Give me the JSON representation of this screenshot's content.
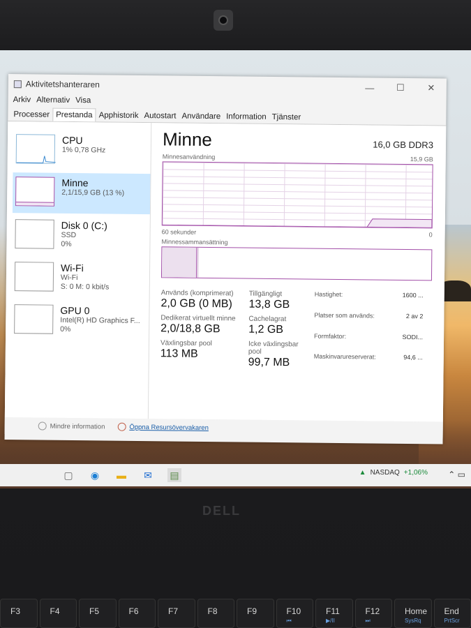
{
  "window": {
    "title": "Aktivitetshanteraren"
  },
  "menu": [
    "Arkiv",
    "Alternativ",
    "Visa"
  ],
  "tabs": [
    "Processer",
    "Prestanda",
    "Apphistorik",
    "Autostart",
    "Användare",
    "Information",
    "Tjänster"
  ],
  "active_tab": "Prestanda",
  "sidebar": [
    {
      "title": "CPU",
      "line1": "1% 0,78 GHz",
      "line2": ""
    },
    {
      "title": "Minne",
      "line1": "2,1/15,9 GB (13 %)",
      "line2": ""
    },
    {
      "title": "Disk 0 (C:)",
      "line1": "SSD",
      "line2": "0%"
    },
    {
      "title": "Wi-Fi",
      "line1": "Wi-Fi",
      "line2": "S: 0 M: 0 kbit/s"
    },
    {
      "title": "GPU 0",
      "line1": "Intel(R) HD Graphics F...",
      "line2": "0%"
    }
  ],
  "memory": {
    "title": "Minne",
    "spec": "16,0 GB DDR3",
    "usage_label": "Minnesanvändning",
    "usage_max": "15,9 GB",
    "time_label": "60 sekunder",
    "time_end": "0",
    "composition_label": "Minnessammansättning",
    "usage_fraction": 0.13,
    "stats": {
      "used_label": "Används (komprimerat)",
      "used": "2,0 GB (0 MB)",
      "avail_label": "Tillgängligt",
      "avail": "13,8 GB",
      "committed_label": "Dedikerat virtuellt minne",
      "committed": "2,0/18,8 GB",
      "cached_label": "Cachelagrat",
      "cached": "1,2 GB",
      "paged_label": "Växlingsbar pool",
      "paged": "113 MB",
      "nonpaged_label": "Icke växlingsbar pool",
      "nonpaged": "99,7 MB"
    },
    "details": [
      {
        "label": "Hastighet:",
        "value": "1600 ..."
      },
      {
        "label": "Platser som används:",
        "value": "2 av 2"
      },
      {
        "label": "Formfaktor:",
        "value": "SODI..."
      },
      {
        "label": "Maskinvarureserverat:",
        "value": "94,6 ..."
      }
    ]
  },
  "footer": {
    "less_info": "Mindre information",
    "open_monitor": "Öppna Resursövervakaren"
  },
  "taskbar": {
    "stock_name": "NASDAQ",
    "stock_change": "+1,06%"
  },
  "laptop": {
    "brand": "DELL",
    "keys": [
      {
        "label": "F3",
        "sub": ""
      },
      {
        "label": "F4",
        "sub": ""
      },
      {
        "label": "F5",
        "sub": ""
      },
      {
        "label": "F6",
        "sub": ""
      },
      {
        "label": "F7",
        "sub": ""
      },
      {
        "label": "F8",
        "sub": ""
      },
      {
        "label": "F9",
        "sub": ""
      },
      {
        "label": "F10",
        "sub": "⏮"
      },
      {
        "label": "F11",
        "sub": "▶/II"
      },
      {
        "label": "F12",
        "sub": "⏭"
      },
      {
        "label": "Home",
        "sub": "SysRq"
      },
      {
        "label": "End",
        "sub": "PrtScr"
      }
    ]
  },
  "colors": {
    "memory_accent": "#a24ea8",
    "selection": "#cce8ff"
  }
}
